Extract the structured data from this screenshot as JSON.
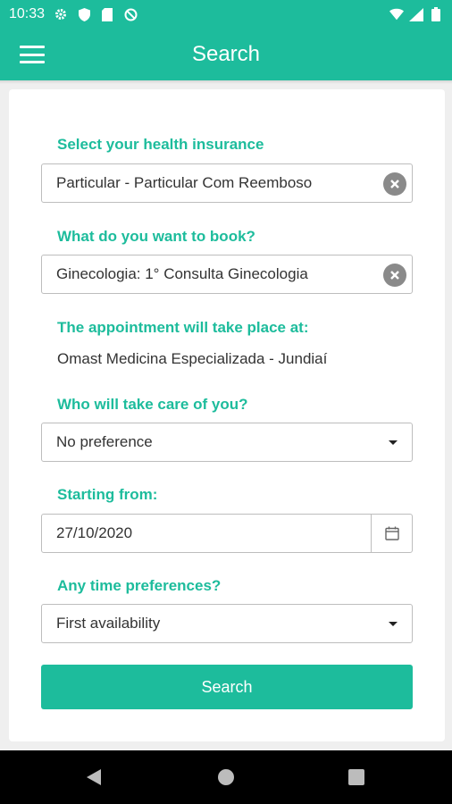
{
  "status_bar": {
    "time": "10:33",
    "left_icons": [
      "gear-icon",
      "shield-icon",
      "sd-card-icon",
      "no-disturb-icon"
    ],
    "right_icons": [
      "wifi-icon",
      "signal-icon",
      "battery-icon"
    ]
  },
  "app_bar": {
    "title": "Search",
    "menu_icon": "hamburger-menu-icon"
  },
  "form": {
    "insurance": {
      "label": "Select your health insurance",
      "value": "Particular - Particular Com Reemboso"
    },
    "booking": {
      "label": "What do you want to book?",
      "value": "Ginecologia: 1° Consulta Ginecologia"
    },
    "location": {
      "label": "The appointment will take place at:",
      "value": "Omast Medicina Especializada - Jundiaí"
    },
    "doctor": {
      "label": "Who will take care of you?",
      "value": "No preference"
    },
    "start_date": {
      "label": "Starting from:",
      "value": "27/10/2020"
    },
    "time_preference": {
      "label": "Any time preferences?",
      "value": "First availability"
    },
    "search_button": "Search"
  },
  "colors": {
    "accent": "#1dbc9c",
    "nav_bar": "#000000",
    "background": "#efefef"
  }
}
